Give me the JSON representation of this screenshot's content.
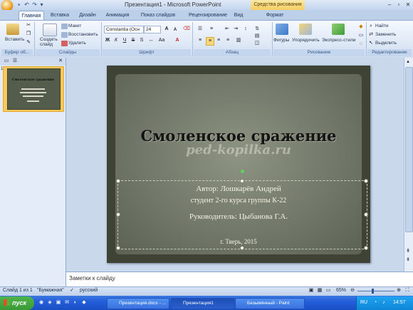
{
  "window": {
    "title": "Презентация1 - Microsoft PowerPoint",
    "context_tab_title": "Средства рисования"
  },
  "tabs": [
    "Главная",
    "Вставка",
    "Дизайн",
    "Анимация",
    "Показ слайдов",
    "Рецензирование",
    "Вид",
    "Формат"
  ],
  "ribbon": {
    "clipboard": {
      "paste": "Вставить",
      "label": "Буфер об..."
    },
    "slides": {
      "create": "Создать слайд",
      "layout": "Макет",
      "reset": "Восстановить",
      "delete": "Удалить",
      "label": "Слайды"
    },
    "font": {
      "name": "Constantia (Осн",
      "size": "24",
      "label": "Шрифт"
    },
    "paragraph": {
      "label": "Абзац"
    },
    "drawing": {
      "shapes": "Фигуры",
      "arrange": "Упорядочить",
      "quick_styles": "Экспресс-стили",
      "label": "Рисование"
    },
    "editing": {
      "find": "Найти",
      "replace": "Заменить",
      "select": "Выделить",
      "label": "Редактирование"
    }
  },
  "slide": {
    "title": "Смоленское сражение",
    "watermark": "ped-kopilka.ru",
    "author_line": "Автор:  Лошкарёв Андрей",
    "student_line": "студент 2-го курса группы К-22",
    "supervisor_line": "Руководитель: Цыбанова Г.А.",
    "city_year": "г. Тверь, 2015"
  },
  "thumbnail": {
    "number": "1"
  },
  "notes_placeholder": "Заметки к слайду",
  "status": {
    "slide_info": "Слайд 1 из 1",
    "theme": "\"Бумажная\"",
    "language": "русский",
    "zoom": "65%"
  },
  "taskbar": {
    "start": "пуск",
    "items": [
      "Презентация.docx - ...",
      "Презентация1",
      "Безымянный - Paint"
    ],
    "tray_lang": "RU",
    "clock": "14:57"
  },
  "colors": {
    "slide_bg": "#72786a",
    "accent": "#f4cf62",
    "taskbar": "#245edb"
  }
}
